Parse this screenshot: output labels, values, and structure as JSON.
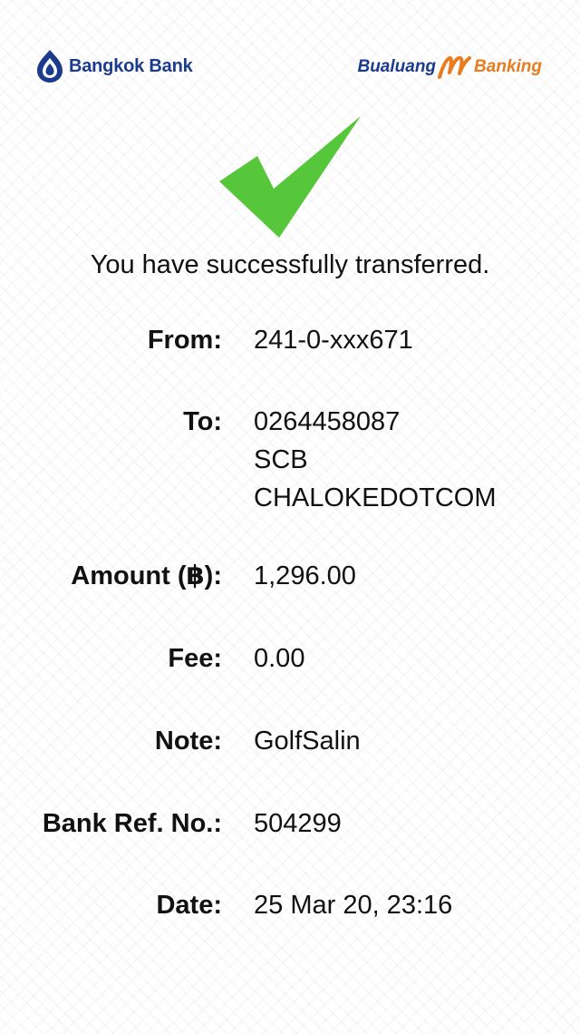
{
  "header": {
    "bank_name": "Bangkok Bank",
    "app_brand_part1": "Bualuang",
    "app_brand_part2": "Banking"
  },
  "colors": {
    "brand_blue": "#1b3c8e",
    "brand_orange": "#e87c1e",
    "success_green": "#56c63a"
  },
  "icons": {
    "success": "checkmark-icon",
    "bank_logo": "bangkok-bank-lotus-icon",
    "app_logo": "m-banking-icon"
  },
  "message": "You have successfully transferred.",
  "details": {
    "from_label": "From:",
    "from_value": "241-0-xxx671",
    "to_label": "To:",
    "to_account": "0264458087",
    "to_bank": "SCB",
    "to_name": "CHALOKEDOTCOM",
    "amount_label": "Amount (฿):",
    "amount_value": "1,296.00",
    "fee_label": "Fee:",
    "fee_value": "0.00",
    "note_label": "Note:",
    "note_value": "GolfSalin",
    "ref_label": "Bank Ref. No.:",
    "ref_value": "504299",
    "date_label": "Date:",
    "date_value": "25 Mar 20, 23:16"
  }
}
